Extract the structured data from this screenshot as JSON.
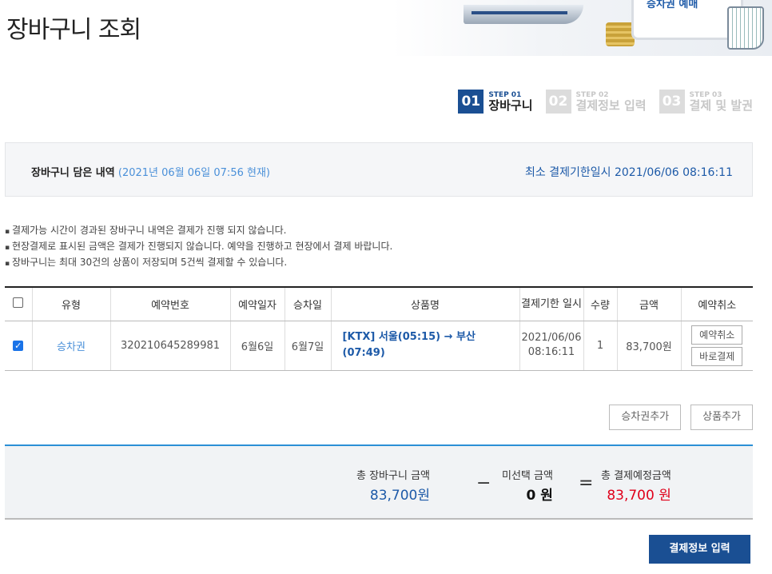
{
  "page": {
    "title": "장바구니 조회"
  },
  "banner": {
    "label": "승차권 예매"
  },
  "steps": [
    {
      "num": "01",
      "small": "STEP 01",
      "label": "장바구니"
    },
    {
      "num": "02",
      "small": "STEP 02",
      "label": "결제정보 입력"
    },
    {
      "num": "03",
      "small": "STEP 03",
      "label": "결제 및 발권"
    }
  ],
  "summary": {
    "label": "장바구니 담은 내역",
    "time": "(2021년 06월 06일 07:56 현재)",
    "deadline": "최소 결제기한일시 2021/06/06 08:16:11"
  },
  "notes": [
    "결제가능 시간이 경과된 장바구니 내역은 결제가 진행 되지 않습니다.",
    "현장결제로 표시된 금액은 결제가 진행되지 않습니다. 예약을 진행하고 현장에서 결제 바랍니다.",
    "장바구니는 최대 30건의 상품이 저장되며 5건씩 결제할 수 있습니다."
  ],
  "table": {
    "headers": [
      "유형",
      "예약번호",
      "예약일자",
      "승차일",
      "상품명",
      "결제기한 일시",
      "수량",
      "금액",
      "예약취소"
    ],
    "rows": [
      {
        "type": "승차권",
        "reservation_no": "320210645289981",
        "reserve_date": "6월6일",
        "ride_date": "6월7일",
        "product": "[KTX] 서울(05:15) → 부산 (07:49)",
        "deadline_date": "2021/06/06",
        "deadline_time": "08:16:11",
        "qty": "1",
        "amount": "83,700원",
        "cancel_label": "예약취소",
        "pay_label": "바로결제"
      }
    ]
  },
  "actions": {
    "add_ticket": "승차권추가",
    "add_product": "상품추가"
  },
  "totals": {
    "total_label": "총 장바구니 금액",
    "total_value": "83,700원",
    "minus": "−",
    "unselected_label": "미선택 금액",
    "unselected_value": "0 원",
    "equals": "=",
    "pay_label": "총 결제예정금액",
    "pay_value": "83,700 원"
  },
  "next": {
    "label": "결제정보 입력"
  },
  "colors": {
    "accent": "#1a4f93",
    "link": "#4a90d9",
    "red": "#e0001a"
  }
}
